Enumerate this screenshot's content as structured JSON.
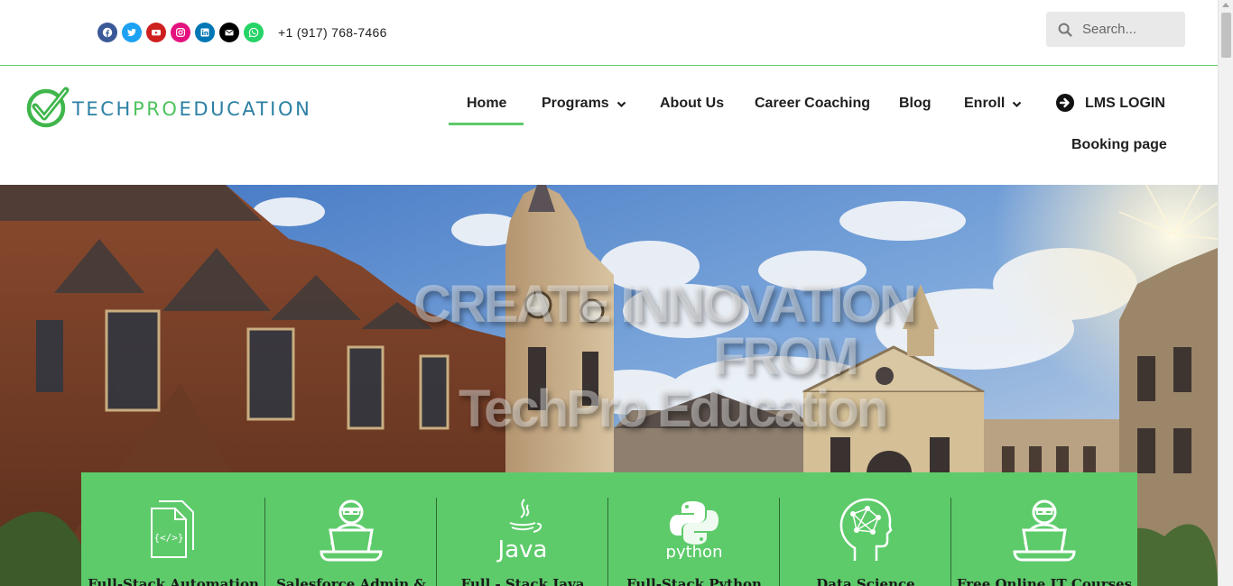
{
  "topbar": {
    "socials": [
      {
        "name": "facebook-icon",
        "color": "#3b5998"
      },
      {
        "name": "twitter-icon",
        "color": "#1da1f2"
      },
      {
        "name": "youtube-icon",
        "color": "#cd201f"
      },
      {
        "name": "instagram-icon",
        "color": "#e4127f"
      },
      {
        "name": "linkedin-icon",
        "color": "#0077b5"
      },
      {
        "name": "email-icon",
        "color": "#000000"
      },
      {
        "name": "whatsapp-icon",
        "color": "#25d366"
      }
    ],
    "phone": "+1 (917) 768-7466",
    "search_placeholder": "Search..."
  },
  "header": {
    "logo": {
      "part1": "TECH",
      "part2": "PRO",
      "part3": "EDUCATION"
    },
    "nav": [
      {
        "label": "Home",
        "active": true
      },
      {
        "label": "Programs",
        "dropdown": true
      },
      {
        "label": "About Us"
      },
      {
        "label": "Career Coaching"
      },
      {
        "label": "Blog"
      },
      {
        "label": "Enroll",
        "dropdown": true
      },
      {
        "label": "LMS LOGIN",
        "icon": "arrow-circle-right-icon"
      },
      {
        "label": "Booking page"
      }
    ]
  },
  "hero": {
    "headline_line1": "CREATE INNOVATION",
    "headline_line2": "FROM",
    "headline_line3": "TechPro Education"
  },
  "programs": {
    "accent": "#5ecb6b",
    "cards": [
      {
        "label": "Full-Stack Automation",
        "icon": "code-document-icon"
      },
      {
        "label": "Salesforce Admin &",
        "icon": "developer-laptop-icon"
      },
      {
        "label": "Full - Stack Java",
        "icon": "java-logo-icon"
      },
      {
        "label": "Full-Stack Python",
        "icon": "python-logo-icon"
      },
      {
        "label": "Data Science",
        "icon": "brain-network-icon"
      },
      {
        "label": "Free Online IT Courses",
        "icon": "developer-laptop-icon"
      }
    ],
    "java_text": "Java",
    "python_text": "python"
  }
}
